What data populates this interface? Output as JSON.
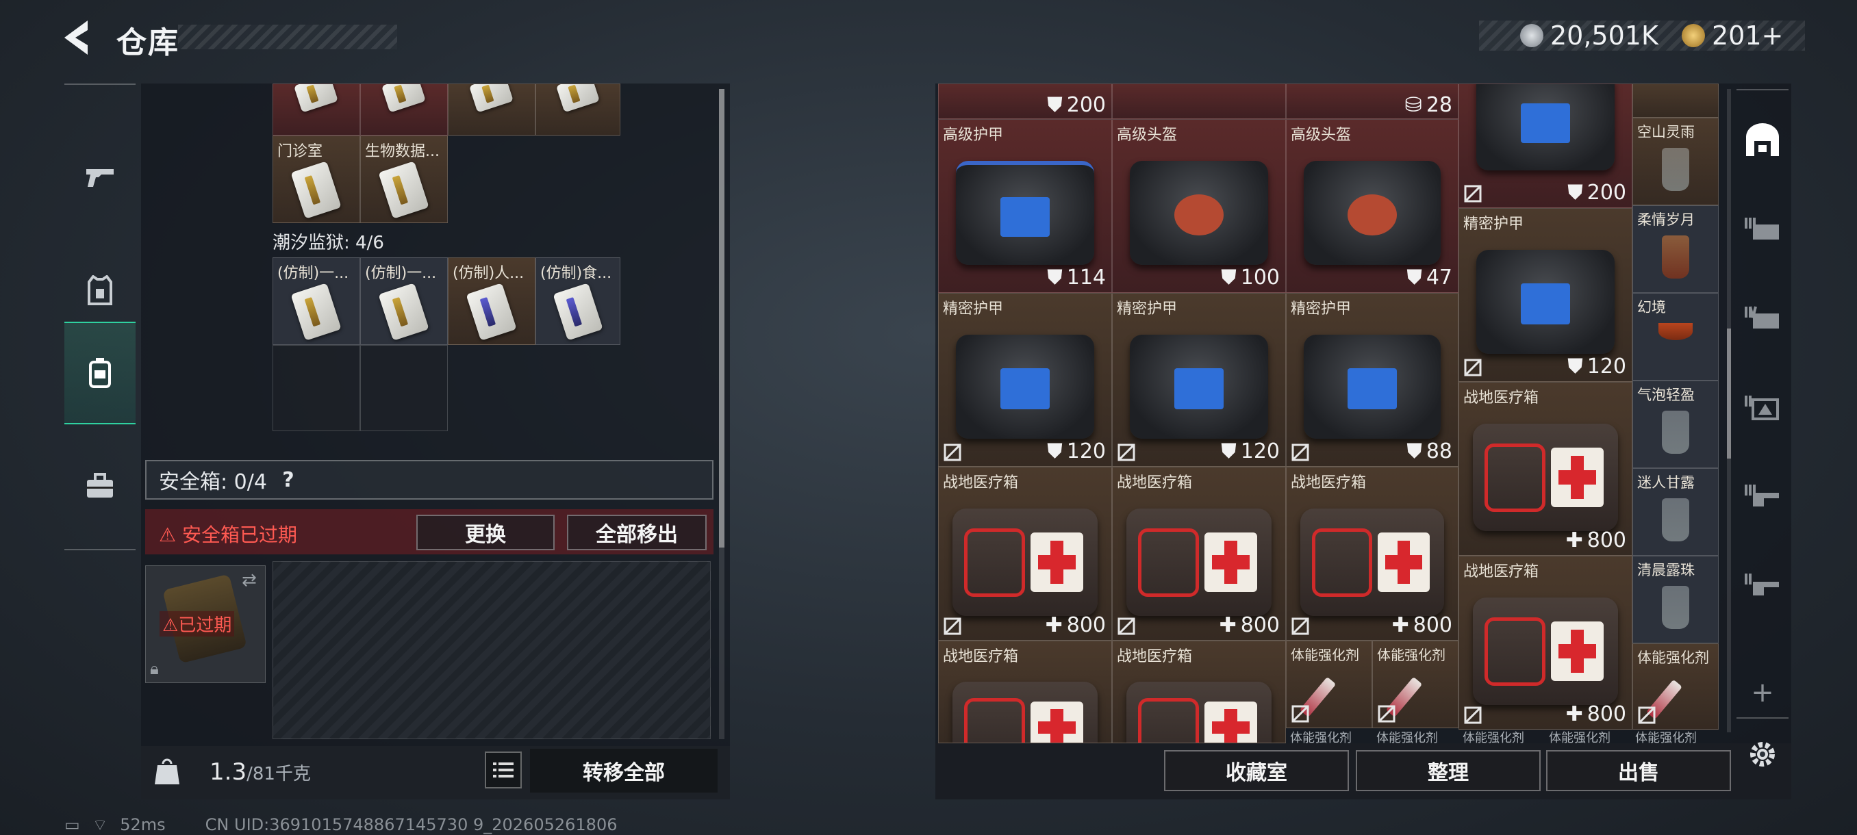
{
  "header": {
    "title": "仓库",
    "currency": [
      {
        "icon": "silver-coin-icon",
        "value": "20,501K"
      },
      {
        "icon": "gold-coin-icon",
        "value": "201+"
      }
    ]
  },
  "left_nav": {
    "items": [
      {
        "name": "weapons",
        "icon": "gun-icon"
      },
      {
        "name": "armor",
        "icon": "armor-vest-icon"
      },
      {
        "name": "backpack",
        "icon": "backpack-icon",
        "active": true
      },
      {
        "name": "toolbox",
        "icon": "toolbox-icon"
      }
    ]
  },
  "left_panel": {
    "top_row_labels": [
      "",
      "",
      "",
      ""
    ],
    "row2": [
      {
        "label": "门诊室"
      },
      {
        "label": "生物数据..."
      }
    ],
    "prison_label": "潮汐监狱: 4/6",
    "prison_items": [
      {
        "label": "(仿制)一..."
      },
      {
        "label": "(仿制)一..."
      },
      {
        "label": "(仿制)人..."
      },
      {
        "label": "(仿制)食..."
      }
    ],
    "safebox_label": "安全箱: 0/4",
    "safebox_help": "?",
    "expired_notice": "安全箱已过期",
    "replace_button": "更换",
    "move_all_out_button": "全部移出",
    "box_expired_tag": "已过期",
    "weight_current": "1.3",
    "weight_max": "/81千克",
    "transfer_all_button": "转移全部"
  },
  "right_panel": {
    "top_partial": [
      {
        "value": "200"
      },
      {
        "value": "28"
      }
    ],
    "items": [
      {
        "name": "高级护甲",
        "value": "114"
      },
      {
        "name": "高级头盔",
        "value": "100"
      },
      {
        "name": "高级头盔",
        "value": "47"
      },
      {
        "name": "精密护甲",
        "value": "120"
      },
      {
        "name": "精密护甲",
        "value": "120"
      },
      {
        "name": "精密护甲",
        "value": "88"
      },
      {
        "name": "战地医疗箱",
        "value": "800"
      },
      {
        "name": "战地医疗箱",
        "value": "800"
      },
      {
        "name": "战地医疗箱",
        "value": "800"
      },
      {
        "name": "战地医疗箱",
        "value": ""
      },
      {
        "name": "战地医疗箱",
        "value": ""
      },
      {
        "name": "体能强化剂",
        "value": ""
      },
      {
        "name": "体能强化剂",
        "value": ""
      }
    ],
    "col4": [
      {
        "name": "",
        "value": "200"
      },
      {
        "name": "精密护甲",
        "value": "120"
      },
      {
        "name": "战地医疗箱",
        "value": "800"
      },
      {
        "name": "战地医疗箱",
        "value": "800"
      }
    ],
    "col5": [
      {
        "name": "空山灵雨"
      },
      {
        "name": "柔情岁月"
      },
      {
        "name": "幻境"
      },
      {
        "name": "气泡轻盈"
      },
      {
        "name": "迷人甘露"
      },
      {
        "name": "清晨露珠"
      },
      {
        "name": "体能强化剂"
      }
    ],
    "bottom_partial_labels": [
      "体能强化剂",
      "体能强化剂",
      "体能强化剂",
      "体能强化剂",
      "体能强化剂"
    ],
    "buttons": {
      "collection": "收藏室",
      "organize": "整理",
      "sell": "出售"
    }
  },
  "right_nav": {
    "items": [
      {
        "name": "storage",
        "icon": "warehouse-icon",
        "active": true
      },
      {
        "name": "tab-3",
        "icon": "storage-3-icon"
      },
      {
        "name": "tab-4",
        "icon": "storage-4-icon"
      },
      {
        "name": "tab-2",
        "icon": "storage-2-icon"
      },
      {
        "name": "tab-3b",
        "icon": "storage-3b-icon"
      },
      {
        "name": "tab-2b",
        "icon": "storage-2b-icon"
      }
    ],
    "add": "+"
  },
  "status": {
    "ping": "52ms",
    "uid": "CN UID:3691015748867145730 9_202605261806"
  },
  "colors": {
    "accent_green": "#2fd1a0",
    "warning_red": "#ff5a52",
    "slot_red": "#5a2a2a",
    "slot_brown": "#4b3a2c"
  }
}
